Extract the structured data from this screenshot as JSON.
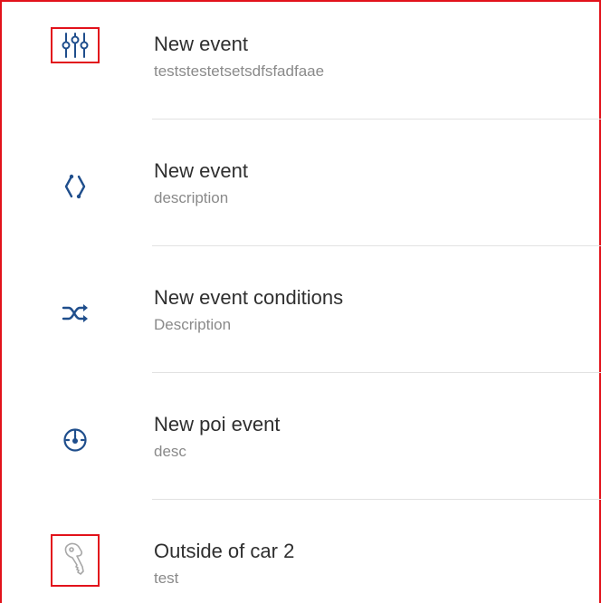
{
  "events": [
    {
      "title": "New event",
      "subtitle": "teststestetsetsdfsfadfaae",
      "icon": "sliders-icon",
      "highlighted": true
    },
    {
      "title": "New event",
      "subtitle": "description",
      "icon": "hexagon-dashed-icon",
      "highlighted": false
    },
    {
      "title": "New event conditions",
      "subtitle": "Description",
      "icon": "shuffle-icon",
      "highlighted": false
    },
    {
      "title": "New poi event",
      "subtitle": "desc",
      "icon": "speedometer-icon",
      "highlighted": false
    },
    {
      "title": "Outside of car 2",
      "subtitle": "test",
      "icon": "car-key-icon",
      "highlighted": true
    }
  ],
  "colors": {
    "icon_blue": "#1f4e8c",
    "key_gray": "#a7a7a7",
    "highlight_red": "#e2121b"
  }
}
